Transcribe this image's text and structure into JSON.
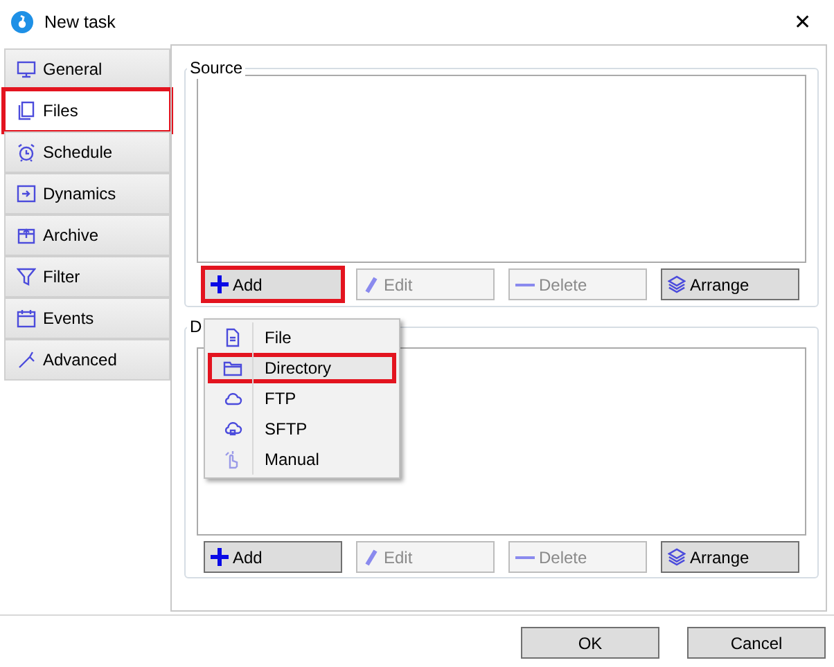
{
  "window": {
    "title": "New task",
    "close": "✕"
  },
  "tabs": [
    {
      "label": "General",
      "selected": false,
      "highlighted": false
    },
    {
      "label": "Files",
      "selected": true,
      "highlighted": true
    },
    {
      "label": "Schedule",
      "selected": false,
      "highlighted": false
    },
    {
      "label": "Dynamics",
      "selected": false,
      "highlighted": false
    },
    {
      "label": "Archive",
      "selected": false,
      "highlighted": false
    },
    {
      "label": "Filter",
      "selected": false,
      "highlighted": false
    },
    {
      "label": "Events",
      "selected": false,
      "highlighted": false
    },
    {
      "label": "Advanced",
      "selected": false,
      "highlighted": false
    }
  ],
  "groups": [
    {
      "legend": "Source",
      "buttons": [
        {
          "label": "Add",
          "disabled": false,
          "highlighted": true
        },
        {
          "label": "Edit",
          "disabled": true,
          "highlighted": false
        },
        {
          "label": "Delete",
          "disabled": true,
          "highlighted": false
        },
        {
          "label": "Arrange",
          "disabled": false,
          "highlighted": false
        }
      ]
    },
    {
      "legend": "D",
      "buttons": [
        {
          "label": "Add",
          "disabled": false,
          "highlighted": false
        },
        {
          "label": "Edit",
          "disabled": true,
          "highlighted": false
        },
        {
          "label": "Delete",
          "disabled": true,
          "highlighted": false
        },
        {
          "label": "Arrange",
          "disabled": false,
          "highlighted": false
        }
      ]
    }
  ],
  "add_menu": {
    "items": [
      {
        "label": "File",
        "highlighted": false
      },
      {
        "label": "Directory",
        "highlighted": true
      },
      {
        "label": "FTP",
        "highlighted": false
      },
      {
        "label": "SFTP",
        "highlighted": false
      },
      {
        "label": "Manual",
        "highlighted": false
      }
    ]
  },
  "footer": {
    "buttons": [
      "OK",
      "Cancel"
    ]
  }
}
